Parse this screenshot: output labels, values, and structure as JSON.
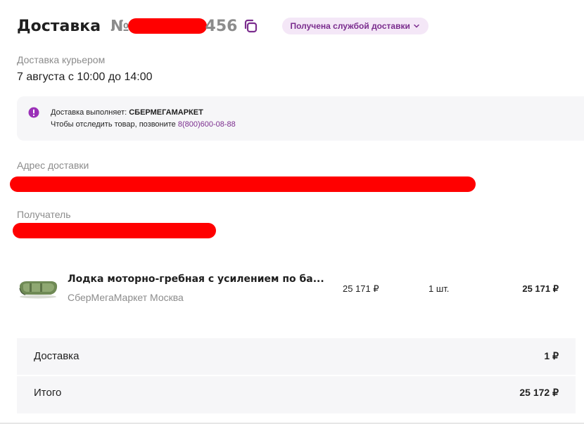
{
  "header": {
    "title": "Доставка",
    "order_prefix": "№",
    "order_suffix": "456",
    "status": "Получена службой доставки"
  },
  "delivery": {
    "type_label": "Доставка курьером",
    "time": "7 августа с 10:00 до 14:00"
  },
  "info": {
    "carrier_label": "Доставка выполняет: ",
    "carrier_name": "СБЕРМЕГАМАРКЕТ",
    "track_text": "Чтобы отследить товар, позвоните ",
    "phone": "8(800)600-08-88"
  },
  "address": {
    "label": "Адрес доставки"
  },
  "recipient": {
    "label": "Получатель"
  },
  "product": {
    "name": "Лодка моторно-гребная с усилением по ба...",
    "seller": "СберМегаМаркет Москва",
    "price": "25 171 ₽",
    "quantity": "1 шт.",
    "total": "25 171 ₽"
  },
  "summary": {
    "delivery_label": "Доставка",
    "delivery_value": "1 ₽",
    "total_label": "Итого",
    "total_value": "25 172 ₽"
  },
  "icons": {
    "copy": "copy-icon",
    "chevron": "chevron-down-icon",
    "info": "info-icon"
  },
  "colors": {
    "accent": "#7b2d8e",
    "badge_bg": "#f4e7f7",
    "panel_bg": "#f6f6f8",
    "redaction": "#ff0000"
  }
}
